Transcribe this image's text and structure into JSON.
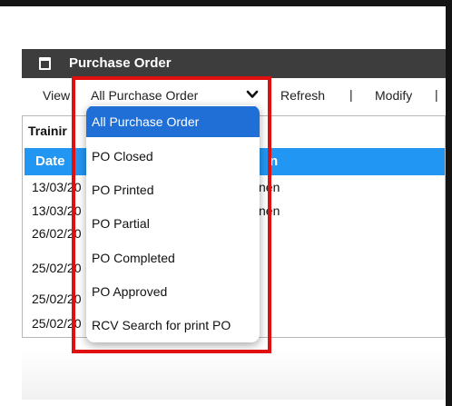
{
  "window": {
    "title": "Purchase Order"
  },
  "toolbar": {
    "view_label": "View",
    "select_value": "All Purchase Order",
    "refresh_label": "Refresh",
    "modify_label": "Modify",
    "separator": "|"
  },
  "panel": {
    "label": "Trainir",
    "header_date": "Date",
    "header_fragment": "n",
    "rows": [
      {
        "date": "13/03/20",
        "frag": "nen"
      },
      {
        "date": "13/03/20",
        "frag": "nen"
      },
      {
        "date": "26/02/20",
        "frag": ""
      },
      {
        "date": "25/02/20",
        "frag": ""
      },
      {
        "date": "25/02/20",
        "frag": ""
      },
      {
        "date": "25/02/20",
        "frag": ""
      }
    ]
  },
  "dropdown": {
    "items": [
      "All Purchase Order",
      "PO Closed",
      "PO Printed",
      "PO Partial",
      "PO Completed",
      "PO Approved",
      "RCV Search for print PO"
    ],
    "selected_index": 0
  },
  "colors": {
    "highlight": "#e01010",
    "grid_header": "#2196f3",
    "selected_item": "#1f6fd6",
    "titlebar": "#3d3d3d"
  },
  "icons": {
    "title_icon": "document-icon",
    "select_chevron": "chevron-down-icon"
  }
}
